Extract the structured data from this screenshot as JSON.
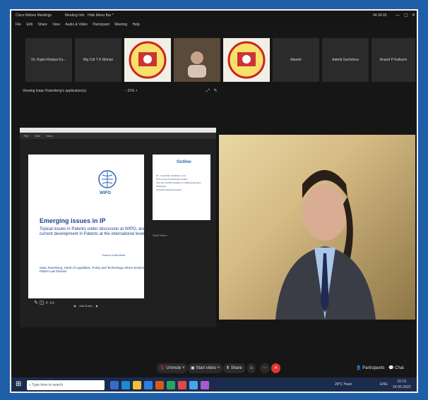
{
  "app": {
    "title": "Cisco Webex Meetings",
    "meeting_info": "Meeting Info",
    "hide_menu": "Hide Menu Bar ^",
    "timer": "04:34:33"
  },
  "menu": [
    "File",
    "Edit",
    "Share",
    "View",
    "Audio & Video",
    "Participant",
    "Meeting",
    "Help"
  ],
  "participants_strip": [
    {
      "name": "Dr. Rajini Khatua Ku...",
      "type": "name"
    },
    {
      "name": "Wg Cdr T K Mohan",
      "type": "name"
    },
    {
      "name": "",
      "type": "logo"
    },
    {
      "name": "",
      "type": "video"
    },
    {
      "name": "",
      "type": "logo"
    },
    {
      "name": "Adarsh",
      "type": "name"
    },
    {
      "name": "Aakriti Sachdeva",
      "type": "name"
    },
    {
      "name": "Anand P Kulkarni",
      "type": "name"
    }
  ],
  "viewing_label": "Viewing Isaac Rutenberg's application(s)",
  "zoom": "31%",
  "slide": {
    "wipo_text": "WIPO",
    "title": "Emerging issues in IP",
    "subtitle": "Topical issues in Patents under discussion at WIPO, and current development in Patents at the international level",
    "presenter": "Osamu Kurtenblad",
    "affiliation": "Isaac Rutenberg, Head of Legislative, Policy and Technology Advice Section, Patent Law Division"
  },
  "thumb": {
    "title": "Outline",
    "items": [
      "IP – ownership, limitations, and...",
      "IP as a tool at technology transfer",
      "The role of WIPO Academy in addressing policy challenges",
      "Outreach/outreach projects"
    ]
  },
  "notes_label": "Slide Notes",
  "notes_placeholder": "Add Notes",
  "share_tool_labels": [
    "File",
    "Edit",
    "View"
  ],
  "controls": {
    "unmute": "Unmute",
    "start_video": "Start video",
    "share": "Share",
    "participants": "Participants",
    "chat": "Chat"
  },
  "taskbar": {
    "search_placeholder": "Type here to search",
    "weather": "28°C Haze",
    "lang": "ENG",
    "time": "10:13",
    "date": "24-05-2022"
  },
  "colors": {
    "accent": "#1e5fa8",
    "end_btn": "#e0362e"
  },
  "icons": [
    "windows-logo-icon",
    "search-icon",
    "task-view-icon",
    "edge-icon",
    "mic-muted-icon",
    "camera-icon",
    "share-icon",
    "reaction-icon",
    "more-icon",
    "end-call-icon",
    "participants-icon",
    "chat-icon"
  ]
}
